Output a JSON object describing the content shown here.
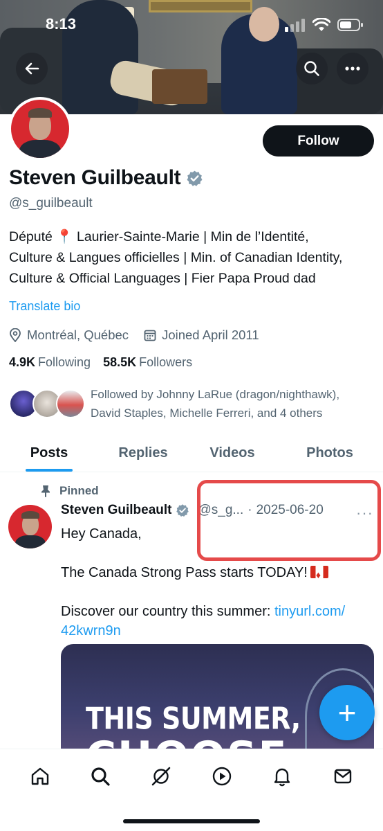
{
  "status_bar": {
    "time": "8:13"
  },
  "profile": {
    "name": "Steven Guilbeault",
    "handle": "@s_guilbeault",
    "follow_label": "Follow",
    "bio_lines": [
      "Député 📍 Laurier-Sainte-Marie | Min de l’Identité,",
      "Culture & Langues officielles | Min. of Canadian Identity,",
      "Culture & Official Languages | Fier Papa Proud dad"
    ],
    "translate_label": "Translate bio",
    "location": "Montréal, Québec",
    "joined": "Joined April 2011",
    "following_count": "4.9K",
    "following_label": "Following",
    "followers_count": "58.5K",
    "followers_label": "Followers",
    "followed_by_line1": "Followed by Johnny LaRue (dragon/nighthawk),",
    "followed_by_line2": "David Staples, Michelle Ferreri, and 4 others"
  },
  "tabs": [
    {
      "label": "Posts",
      "active": true
    },
    {
      "label": "Replies",
      "active": false
    },
    {
      "label": "Videos",
      "active": false
    },
    {
      "label": "Photos",
      "active": false
    }
  ],
  "post": {
    "pinned_label": "Pinned",
    "author_name": "Steven Guilbeault",
    "author_handle": "@s_g...",
    "separator": "·",
    "date": "2025-06-20",
    "more_label": "···",
    "line1": "Hey Canada,",
    "line2": "The Canada Strong Pass starts TODAY!",
    "line3_text": "Discover our country this summer: ",
    "line3_link_a": "tinyurl.com/",
    "line3_link_b": "42kwrn9n",
    "media_title": "THIS SUMMER,",
    "media_subtitle": "CHOOSE"
  },
  "fab_label": "+",
  "colors": {
    "accent": "#1d9bf0",
    "text_primary": "#0f1419",
    "text_secondary": "#536471",
    "highlight": "#e54a4a",
    "avatar_bg": "#d7282f"
  },
  "icons": {
    "banner": [
      "back-arrow-icon",
      "search-icon",
      "more-icon"
    ],
    "meta": [
      "location-icon",
      "calendar-icon"
    ],
    "nav": [
      "home-icon",
      "search-icon",
      "grok-icon",
      "video-icon",
      "notifications-icon",
      "messages-icon"
    ]
  }
}
